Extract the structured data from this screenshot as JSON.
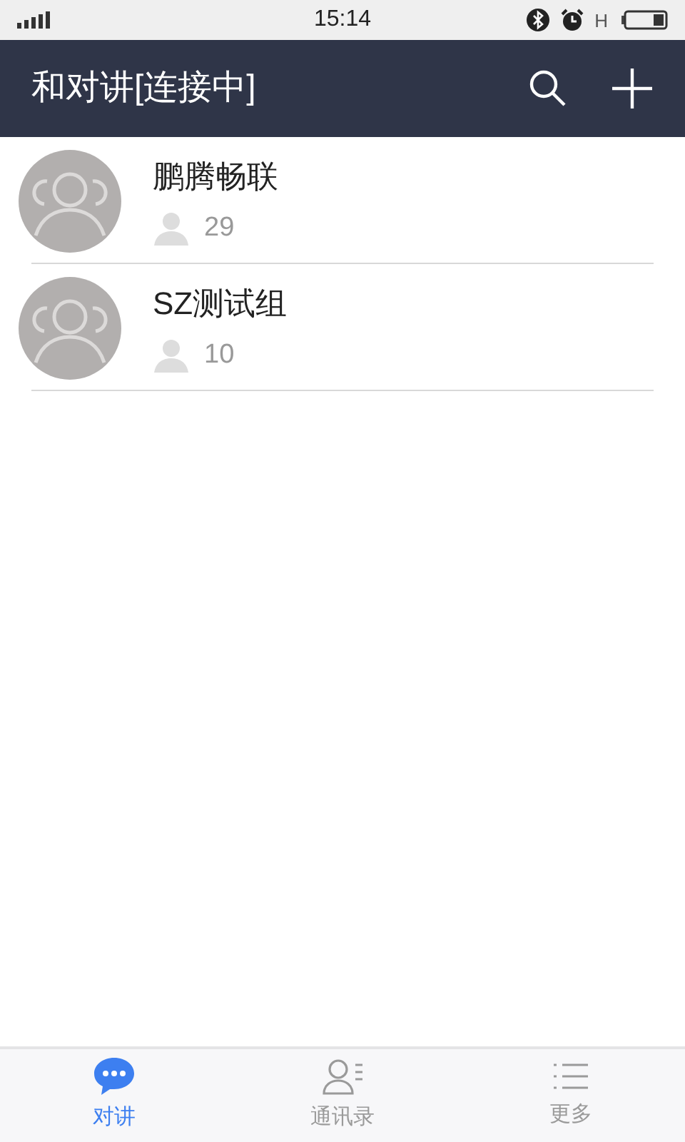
{
  "status_bar": {
    "time": "15:14",
    "network": "H"
  },
  "header": {
    "title": "和对讲[连接中]"
  },
  "groups": [
    {
      "name": "鹏腾畅联",
      "members": "29"
    },
    {
      "name": "SZ测试组",
      "members": "10"
    }
  ],
  "tabs": [
    {
      "label": "对讲",
      "kind": "chat",
      "selected": true
    },
    {
      "label": "通讯录",
      "kind": "contacts",
      "selected": false
    },
    {
      "label": "更多",
      "kind": "more",
      "selected": false
    }
  ]
}
